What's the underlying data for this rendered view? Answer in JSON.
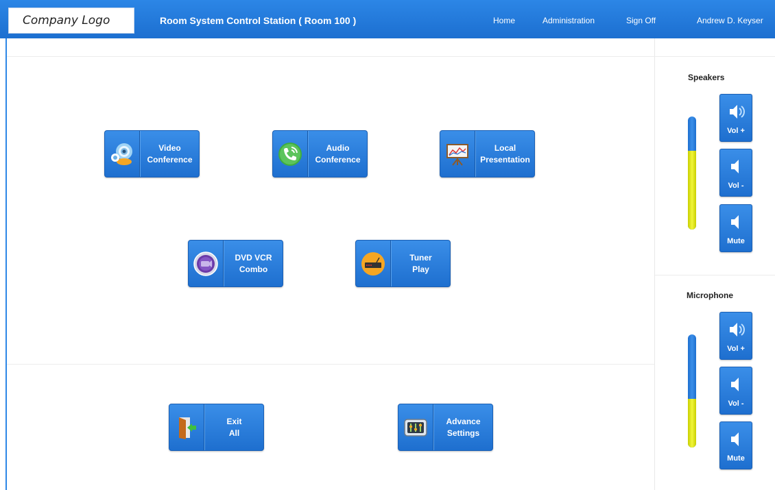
{
  "header": {
    "logo_text": "Company Logo",
    "title": "Room System Control Station ( Room 100 )",
    "nav": {
      "home": "Home",
      "administration": "Administration",
      "sign_off": "Sign Off"
    },
    "user": "Andrew D. Keyser"
  },
  "main": {
    "buttons": {
      "video_conference": {
        "line1": "Video",
        "line2": "Conference",
        "icon": "webcam-icon"
      },
      "audio_conference": {
        "line1": "Audio",
        "line2": "Conference",
        "icon": "phone-icon"
      },
      "local_presentation": {
        "line1": "Local",
        "line2": "Presentation",
        "icon": "presentation-board-icon"
      },
      "dvd_vcr": {
        "line1": "DVD VCR",
        "line2": "Combo",
        "icon": "dvd-icon"
      },
      "tuner": {
        "line1": "Tuner",
        "line2": "Play",
        "icon": "tuner-icon"
      },
      "exit_all": {
        "line1": "Exit",
        "line2": "All",
        "icon": "exit-door-icon"
      },
      "advance_settings": {
        "line1": "Advance",
        "line2": "Settings",
        "icon": "settings-panel-icon"
      }
    }
  },
  "sidebar": {
    "speakers": {
      "title": "Speakers",
      "level_percent": 70,
      "vol_up": "Vol +",
      "vol_down": "Vol -",
      "mute": "Mute"
    },
    "microphone": {
      "title": "Microphone",
      "level_percent": 43,
      "vol_up": "Vol +",
      "vol_down": "Vol -",
      "mute": "Mute"
    }
  },
  "colors": {
    "header_blue": "#2c86e6",
    "button_blue": "#2a7fdf",
    "level_yellow": "#e6eb2a"
  }
}
